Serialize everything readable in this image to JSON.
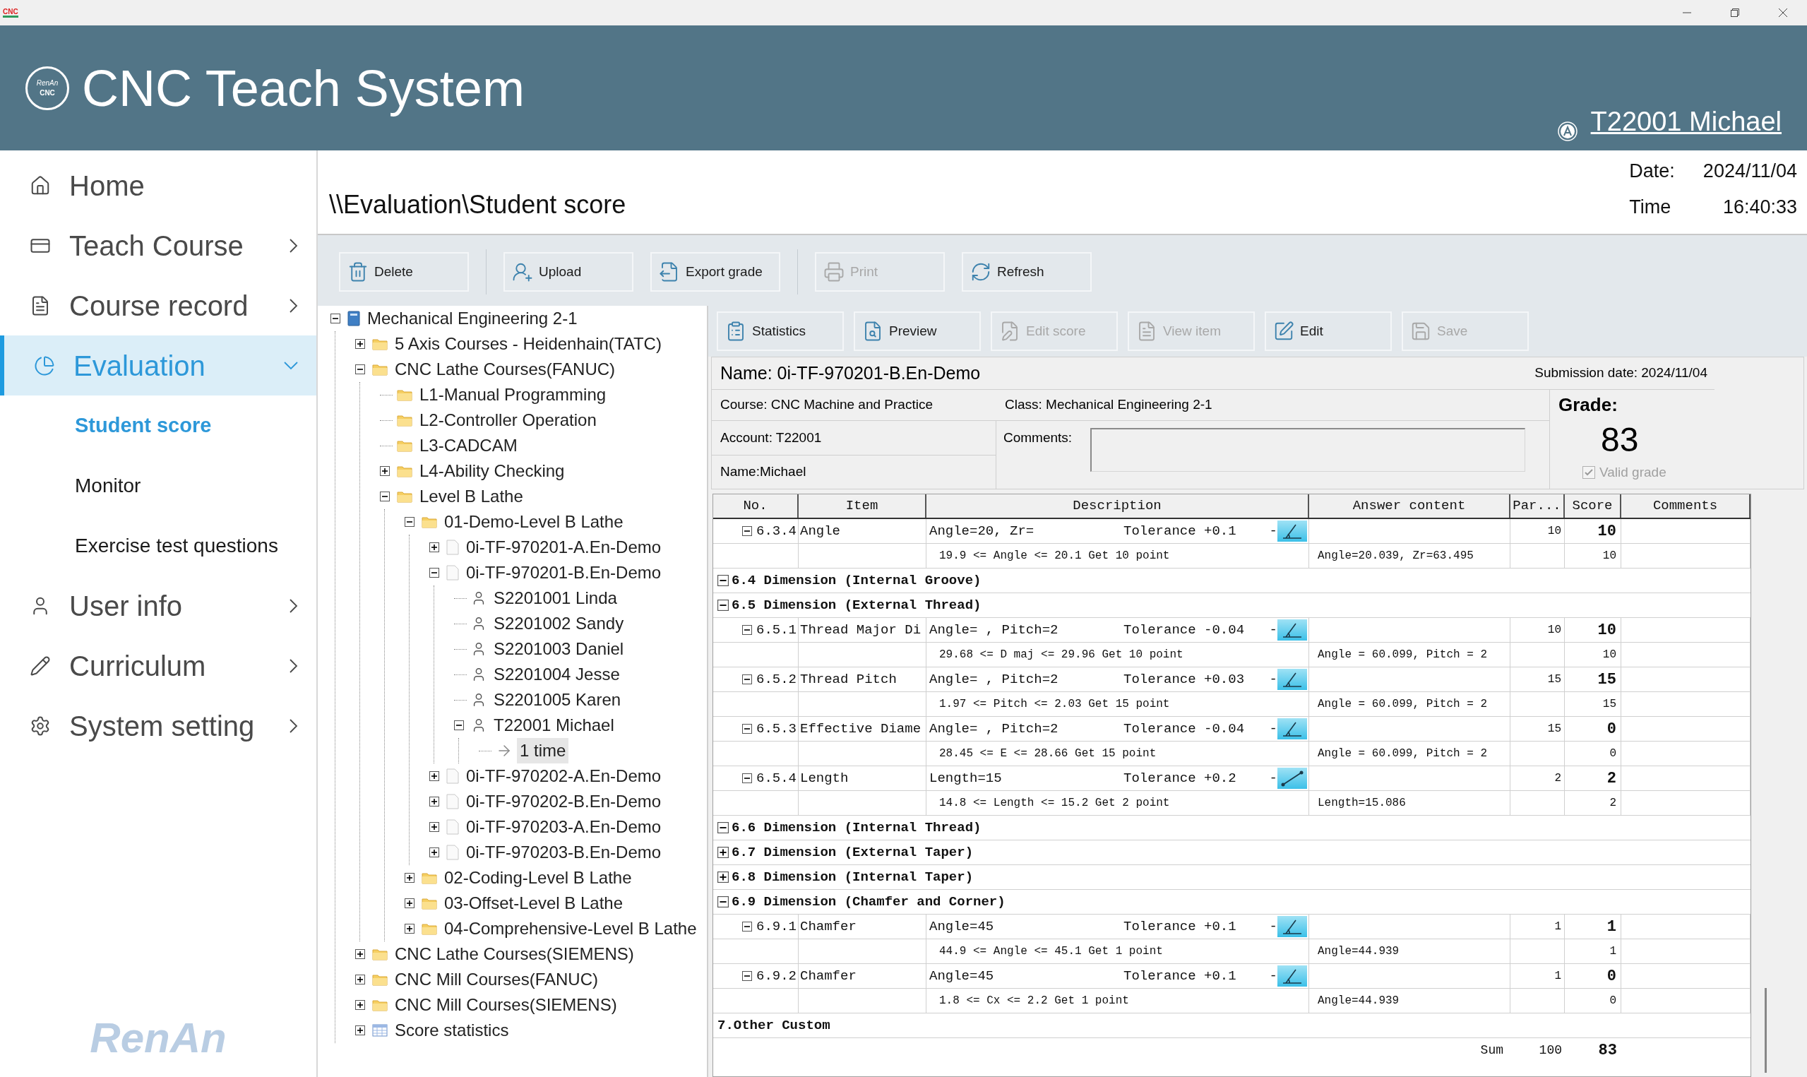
{
  "title_bar": {
    "icon_text": "CNC"
  },
  "header": {
    "logo_top": "RenAn",
    "logo_bottom": "CNC",
    "title": "CNC Teach System",
    "user": "T22001 Michael"
  },
  "sidebar": {
    "items": [
      {
        "label": "Home",
        "selected": false
      },
      {
        "label": "Teach Course",
        "selected": false,
        "expanded": false
      },
      {
        "label": "Course record",
        "selected": false,
        "expanded": false
      },
      {
        "label": "Evaluation",
        "selected": true,
        "expanded": true,
        "children": [
          {
            "label": "Student score",
            "selected": true
          },
          {
            "label": "Monitor",
            "selected": false
          },
          {
            "label": "Exercise test questions",
            "selected": false
          }
        ]
      },
      {
        "label": "User info",
        "selected": false,
        "expanded": false
      },
      {
        "label": "Curriculum",
        "selected": false,
        "expanded": false
      },
      {
        "label": "System setting",
        "selected": false,
        "expanded": false
      }
    ],
    "brand": "RenAn"
  },
  "breadcrumb": "\\\\Evaluation\\Student score",
  "clock": {
    "date_label": "Date:",
    "date": "2024/11/04",
    "time_label": "Time",
    "time": "16:40:33"
  },
  "toolbar": [
    {
      "label": "Delete",
      "disabled": false
    },
    {
      "label": "Upload",
      "disabled": false
    },
    {
      "label": "Export grade",
      "disabled": false
    },
    {
      "label": "Print",
      "disabled": true
    },
    {
      "label": "Refresh",
      "disabled": false
    }
  ],
  "tree": {
    "nodes": [
      {
        "label": "Mechanical Engineering 2-1",
        "kind": "class",
        "expanded": true,
        "selected": false,
        "children": [
          {
            "label": "5 Axis Courses - Heidenhain(TATC)",
            "kind": "folder",
            "expanded": false,
            "selected": false
          },
          {
            "label": "CNC Lathe Courses(FANUC)",
            "kind": "folder",
            "expanded": true,
            "selected": false,
            "children": [
              {
                "label": "L1-Manual Programming",
                "kind": "folder",
                "selected": false
              },
              {
                "label": "L2-Controller Operation",
                "kind": "folder",
                "selected": false
              },
              {
                "label": "L3-CADCAM",
                "kind": "folder",
                "selected": false
              },
              {
                "label": "L4-Ability Checking",
                "kind": "folder",
                "expanded": false,
                "selected": false
              },
              {
                "label": "Level B Lathe",
                "kind": "folder",
                "expanded": true,
                "selected": false,
                "children": [
                  {
                    "label": "01-Demo-Level B Lathe",
                    "kind": "folder",
                    "expanded": true,
                    "selected": false,
                    "children": [
                      {
                        "label": "0i-TF-970201-A.En-Demo",
                        "kind": "file",
                        "expanded": false,
                        "selected": false
                      },
                      {
                        "label": "0i-TF-970201-B.En-Demo",
                        "kind": "file",
                        "expanded": true,
                        "selected": false,
                        "children": [
                          {
                            "label": "S2201001 Linda",
                            "kind": "person",
                            "selected": false
                          },
                          {
                            "label": "S2201002 Sandy",
                            "kind": "person",
                            "selected": false
                          },
                          {
                            "label": "S2201003 Daniel",
                            "kind": "person",
                            "selected": false
                          },
                          {
                            "label": "S2201004 Jesse",
                            "kind": "person",
                            "selected": false
                          },
                          {
                            "label": "S2201005 Karen",
                            "kind": "person",
                            "selected": false
                          },
                          {
                            "label": "T22001 Michael",
                            "kind": "person",
                            "expanded": true,
                            "selected": false,
                            "children": [
                              {
                                "label": "1 time",
                                "kind": "attempt",
                                "selected": true
                              }
                            ]
                          }
                        ]
                      },
                      {
                        "label": "0i-TF-970202-A.En-Demo",
                        "kind": "file",
                        "expanded": false,
                        "selected": false
                      },
                      {
                        "label": "0i-TF-970202-B.En-Demo",
                        "kind": "file",
                        "expanded": false,
                        "selected": false
                      },
                      {
                        "label": "0i-TF-970203-A.En-Demo",
                        "kind": "file",
                        "expanded": false,
                        "selected": false
                      },
                      {
                        "label": "0i-TF-970203-B.En-Demo",
                        "kind": "file",
                        "expanded": false,
                        "selected": false
                      }
                    ]
                  },
                  {
                    "label": "02-Coding-Level B Lathe",
                    "kind": "folder",
                    "expanded": false,
                    "selected": false
                  },
                  {
                    "label": "03-Offset-Level B Lathe",
                    "kind": "folder",
                    "expanded": false,
                    "selected": false
                  },
                  {
                    "label": "04-Comprehensive-Level B Lathe",
                    "kind": "folder",
                    "expanded": false,
                    "selected": false
                  }
                ]
              }
            ]
          },
          {
            "label": "CNC Lathe Courses(SIEMENS)",
            "kind": "folder",
            "expanded": false,
            "selected": false
          },
          {
            "label": "CNC Mill Courses(FANUC)",
            "kind": "folder",
            "expanded": false,
            "selected": false
          },
          {
            "label": "CNC Mill Courses(SIEMENS)",
            "kind": "folder",
            "expanded": false,
            "selected": false
          },
          {
            "label": "Score statistics",
            "kind": "statistics",
            "expanded": false,
            "selected": false
          }
        ]
      }
    ]
  },
  "score_toolbar": [
    {
      "label": "Statistics",
      "disabled": false
    },
    {
      "label": "Preview",
      "disabled": false
    },
    {
      "label": "Edit score",
      "disabled": true
    },
    {
      "label": "View item",
      "disabled": true
    },
    {
      "label": "Edit",
      "disabled": false
    },
    {
      "label": "Save",
      "disabled": true
    }
  ],
  "record": {
    "name": "Name: 0i-TF-970201-B.En-Demo",
    "submission": "Submission date: 2024/11/04",
    "course": "Course: CNC Machine and Practice",
    "class": "Class: Mechanical Engineering 2-1",
    "account": "Account: T22001",
    "student": "Name:Michael",
    "comments_label": "Comments:",
    "grade_label": "Grade:",
    "grade": "83",
    "valid_grade": {
      "label": "Valid grade",
      "checked": true
    }
  },
  "table": {
    "columns": [
      "No.",
      "Item",
      "Description",
      "Answer content",
      "Par...",
      "Score",
      "Comments"
    ],
    "rows": [
      {
        "kind": "item",
        "expanded": true,
        "no": "6.3.4",
        "item": "Angle",
        "description": "Angle=20, Zr=",
        "tolerance": "Tolerance +0.1",
        "gauge": {
          "kind": "angle",
          "dash": "-"
        },
        "par": "10",
        "score": "10"
      },
      {
        "kind": "detail",
        "range": "19.9 <= Angle <= 20.1 Get 10 point",
        "answer": "Angle=20.039, Zr=63.495",
        "score": "10"
      },
      {
        "kind": "group",
        "expanded": true,
        "title": "6.4 Dimension (Internal Groove)"
      },
      {
        "kind": "group",
        "expanded": true,
        "title": "6.5 Dimension (External Thread)"
      },
      {
        "kind": "item",
        "expanded": true,
        "no": "6.5.1",
        "item": "Thread Major Di",
        "description": "Angle= , Pitch=2",
        "tolerance": "Tolerance -0.04",
        "gauge": {
          "kind": "angle",
          "dash": "-"
        },
        "par": "10",
        "score": "10"
      },
      {
        "kind": "detail",
        "range": "29.68 <= D maj <= 29.96 Get 10 point",
        "answer": "Angle = 60.099, Pitch = 2",
        "score": "10"
      },
      {
        "kind": "item",
        "expanded": true,
        "no": "6.5.2",
        "item": "Thread Pitch",
        "description": "Angle= , Pitch=2",
        "tolerance": "Tolerance +0.03",
        "gauge": {
          "kind": "angle",
          "dash": "-"
        },
        "par": "15",
        "score": "15"
      },
      {
        "kind": "detail",
        "range": "1.97 <= Pitch <= 2.03 Get 15 point",
        "answer": "Angle = 60.099, Pitch = 2",
        "score": "15"
      },
      {
        "kind": "item",
        "expanded": true,
        "no": "6.5.3",
        "item": "Effective Diame",
        "description": "Angle= , Pitch=2",
        "tolerance": "Tolerance -0.04",
        "gauge": {
          "kind": "angle",
          "dash": "-"
        },
        "par": "15",
        "score": "0"
      },
      {
        "kind": "detail",
        "range": "28.45 <= E <= 28.66 Get 15 point",
        "answer": "Angle = 60.099, Pitch = 2",
        "score": "0"
      },
      {
        "kind": "item",
        "expanded": true,
        "no": "6.5.4",
        "item": "Length",
        "description": "Length=15",
        "tolerance": "Tolerance +0.2",
        "gauge": {
          "kind": "length",
          "dash": "-"
        },
        "par": "2",
        "score": "2"
      },
      {
        "kind": "detail",
        "range": "14.8 <= Length <= 15.2 Get 2 point",
        "answer": "Length=15.086",
        "score": "2"
      },
      {
        "kind": "group",
        "expanded": true,
        "title": "6.6 Dimension (Internal Thread)"
      },
      {
        "kind": "group",
        "expanded": false,
        "title": "6.7 Dimension (External Taper)"
      },
      {
        "kind": "group",
        "expanded": false,
        "title": "6.8 Dimension (Internal Taper)"
      },
      {
        "kind": "group",
        "expanded": true,
        "title": "6.9 Dimension (Chamfer and Corner)"
      },
      {
        "kind": "item",
        "expanded": true,
        "no": "6.9.1",
        "item": "Chamfer",
        "description": "Angle=45",
        "tolerance": "Tolerance +0.1",
        "gauge": {
          "kind": "angle",
          "dash": "-"
        },
        "par": "1",
        "score": "1"
      },
      {
        "kind": "detail",
        "range": "44.9 <= Angle <= 45.1 Get 1 point",
        "answer": "Angle=44.939",
        "score": "1"
      },
      {
        "kind": "item",
        "expanded": true,
        "no": "6.9.2",
        "item": "Chamfer",
        "description": "Angle=45",
        "tolerance": "Tolerance +0.1",
        "gauge": {
          "kind": "angle",
          "dash": "-"
        },
        "par": "1",
        "score": "0"
      },
      {
        "kind": "detail",
        "range": "1.8 <= Cx <= 2.2 Get 1 point",
        "answer": "Angle=44.939",
        "score": "0"
      },
      {
        "kind": "section",
        "title": "7.Other Custom"
      }
    ],
    "sum": {
      "label": "Sum",
      "par": "100",
      "score": "83"
    }
  }
}
